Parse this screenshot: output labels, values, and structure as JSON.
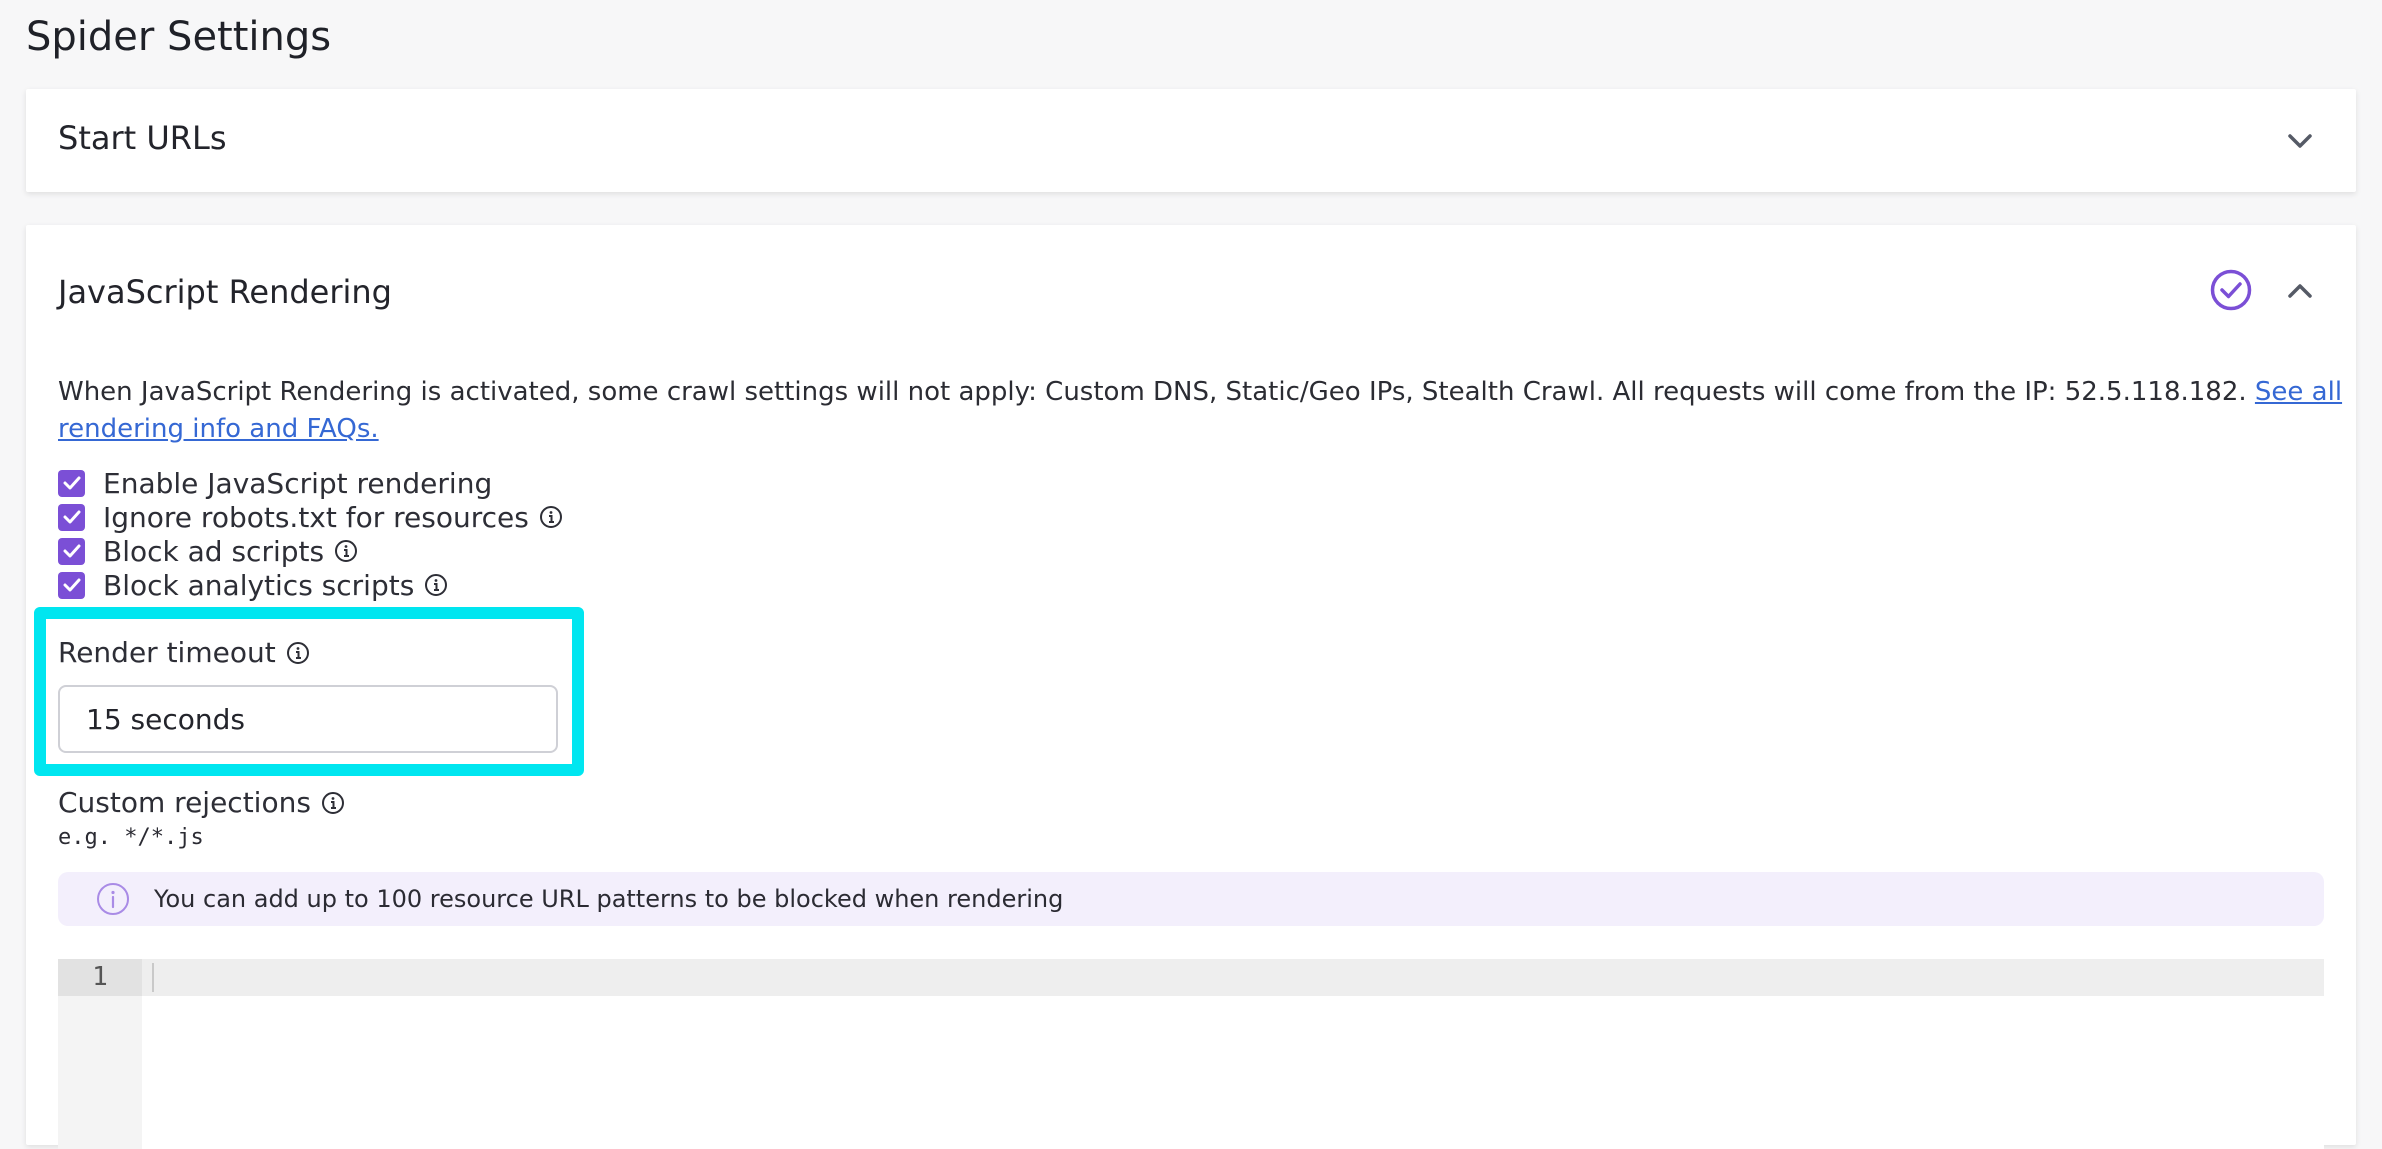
{
  "page": {
    "title": "Spider Settings"
  },
  "start_urls": {
    "title": "Start URLs",
    "expanded": false
  },
  "js_rendering": {
    "title": "JavaScript Rendering",
    "expanded": true,
    "enabled": true,
    "accent_color": "#7b4fd6",
    "notice": "When JavaScript Rendering is activated, some crawl settings will not apply: Custom DNS, Static/Geo IPs, Stealth Crawl. All requests will come from the IP: 52.5.118.182.",
    "notice_link": "See all rendering info and FAQs.",
    "options": [
      {
        "label": "Enable JavaScript rendering",
        "checked": true,
        "info": false
      },
      {
        "label": "Ignore robots.txt for resources",
        "checked": true,
        "info": true
      },
      {
        "label": "Block ad scripts",
        "checked": true,
        "info": true
      },
      {
        "label": "Block analytics scripts",
        "checked": true,
        "info": true
      }
    ],
    "render_timeout": {
      "label": "Render timeout",
      "value": "15 seconds"
    },
    "custom_rejections": {
      "label": "Custom rejections",
      "example": "e.g. */*.js",
      "info_banner": "You can add up to 100 resource URL patterns to be blocked when rendering",
      "editor_line_number": "1",
      "editor_value": ""
    }
  },
  "highlight_color": "#00e6f0"
}
